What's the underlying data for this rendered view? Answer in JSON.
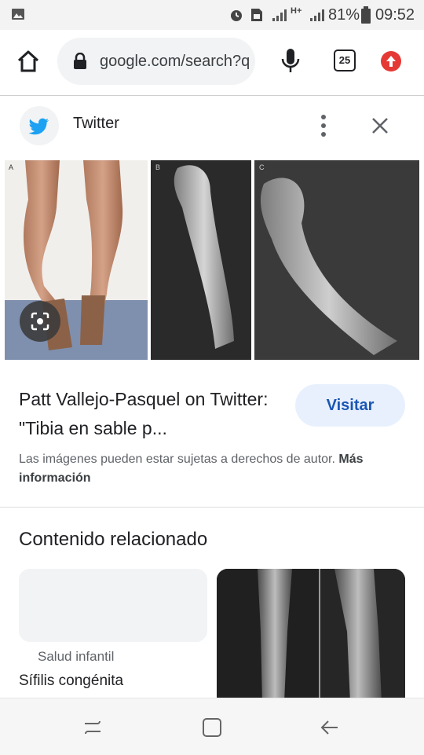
{
  "status_bar": {
    "battery_percent": "81%",
    "time": "09:52",
    "network_type": "H+",
    "icons": [
      "gallery-icon",
      "alarm-icon",
      "sim-icon",
      "signal-icon",
      "signal-icon",
      "battery-icon"
    ]
  },
  "browser": {
    "url": "google.com/search?q",
    "tab_count": "25",
    "icons": [
      "home-icon",
      "lock-icon",
      "mic-icon",
      "tabs-icon",
      "update-icon"
    ]
  },
  "source": {
    "name": "Twitter",
    "icons": [
      "twitter-logo",
      "more-vert-icon",
      "close-icon"
    ]
  },
  "preview": {
    "panel_labels": [
      "A",
      "B",
      "C"
    ],
    "lens_icon": "lens-icon"
  },
  "result": {
    "title": "Patt Vallejo-Pasquel on Twitter: \"Tibia en sable p...",
    "visit_label": "Visitar",
    "copyright_text": "Las imágenes pueden estar sujetas a derechos de autor.",
    "more_info_label": "Más información"
  },
  "related": {
    "heading": "Contenido relacionado",
    "card_category": "Salud infantil",
    "card_title": "Sífilis congénita"
  },
  "nav_bar": {
    "icons": [
      "recents-icon",
      "home-button-icon",
      "back-icon"
    ]
  },
  "colors": {
    "accent": "#1a56b4",
    "button_bg": "#e8f0fe",
    "twitter_blue": "#1da1f2",
    "update_red": "#e53935"
  }
}
